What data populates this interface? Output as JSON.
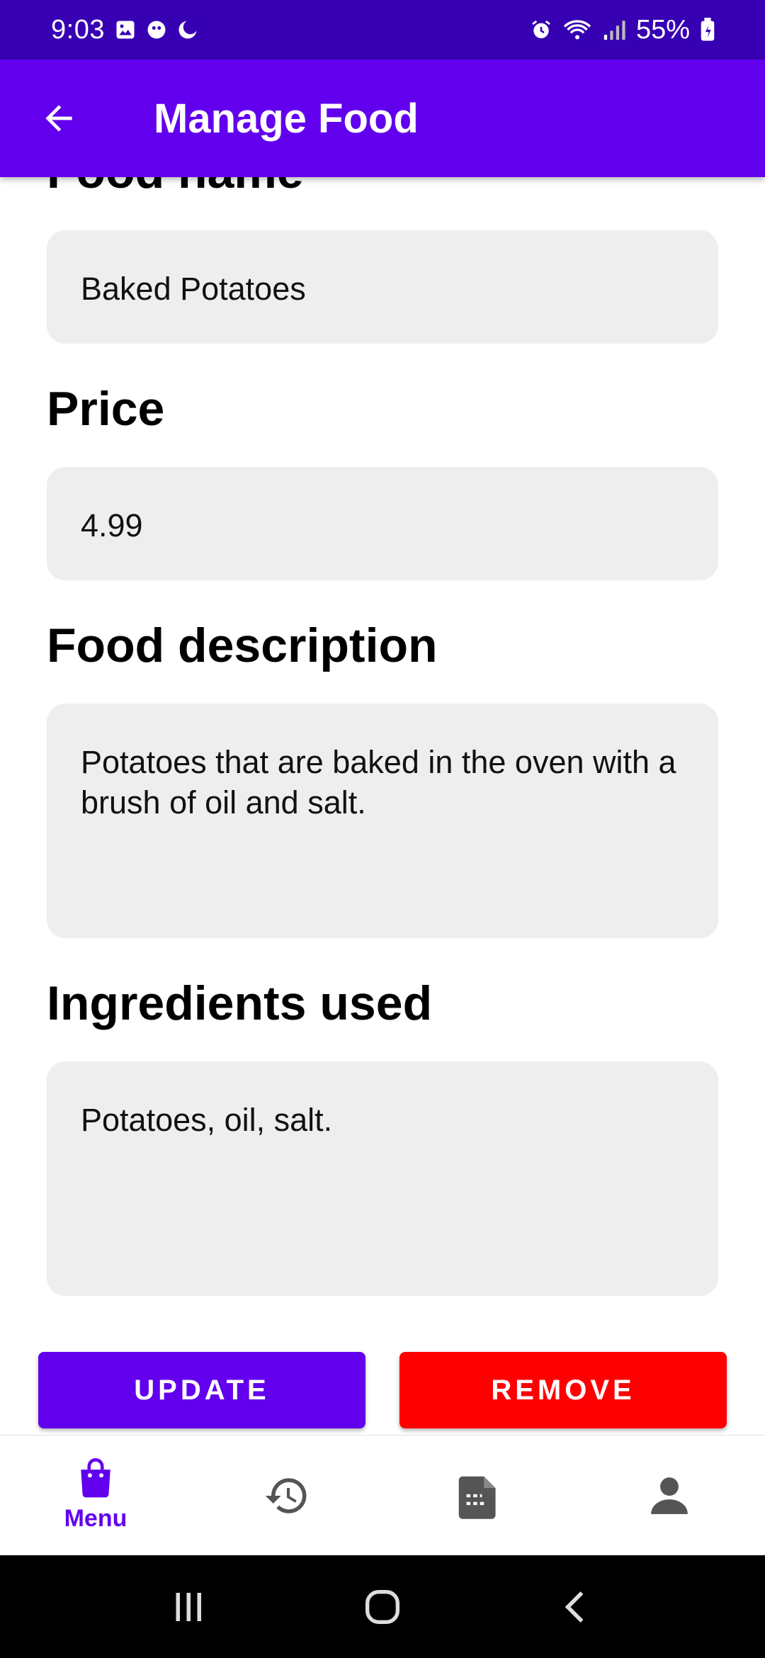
{
  "status_bar": {
    "time": "9:03",
    "battery": "55%",
    "icons": [
      "gallery-icon",
      "app-notification-icon",
      "do-not-disturb-icon",
      "alarm-icon",
      "wifi-icon",
      "signal-icon",
      "battery-icon"
    ]
  },
  "app_bar": {
    "title": "Manage Food",
    "back_icon": "arrow-left-icon"
  },
  "form": {
    "food_name_label": "Food name",
    "food_name_value": "Baked Potatoes",
    "price_label": "Price",
    "price_value": "4.99",
    "description_label": "Food description",
    "description_value": "Potatoes that are baked in the oven with a brush of oil and salt.",
    "ingredients_label": "Ingredients used",
    "ingredients_value": "Potatoes, oil, salt."
  },
  "actions": {
    "update_label": "UPDATE",
    "remove_label": "REMOVE"
  },
  "bottom_nav": {
    "items": [
      {
        "label": "Menu",
        "icon": "shopping-bag-icon",
        "selected": true
      },
      {
        "label": "",
        "icon": "history-icon",
        "selected": false
      },
      {
        "label": "",
        "icon": "document-icon",
        "selected": false
      },
      {
        "label": "",
        "icon": "person-icon",
        "selected": false
      }
    ]
  },
  "colors": {
    "status_bar": "#3700b3",
    "primary": "#6200ee",
    "danger": "#ff0000",
    "field_bg": "#eeeeee",
    "nav_inactive": "#555555"
  }
}
